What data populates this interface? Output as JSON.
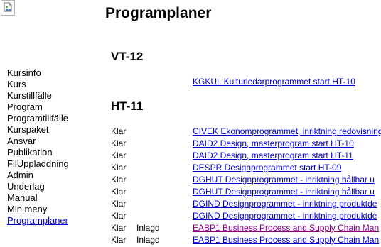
{
  "page": {
    "title": "Programplaner"
  },
  "sidebar": {
    "items": [
      {
        "label": "Kursinfo",
        "active": false
      },
      {
        "label": "Kurs",
        "active": false
      },
      {
        "label": "Kurstillfälle",
        "active": false
      },
      {
        "label": "Program",
        "active": false
      },
      {
        "label": "Programtillfälle",
        "active": false
      },
      {
        "label": "Kurspaket",
        "active": false
      },
      {
        "label": "Ansvar",
        "active": false
      },
      {
        "label": "Publikation",
        "active": false
      },
      {
        "label": "FilUppladdning",
        "active": false
      },
      {
        "label": "Admin",
        "active": false
      },
      {
        "label": "Underlag",
        "active": false
      },
      {
        "label": "Manual",
        "active": false
      },
      {
        "label": "Min meny",
        "active": false
      },
      {
        "label": "Programplaner",
        "active": true
      }
    ]
  },
  "sections": [
    {
      "heading": "VT-12",
      "rows": [
        {
          "status": "",
          "registered": "",
          "link": "KGKUL Kulturledarprogrammet start HT-10",
          "visited": false
        }
      ]
    },
    {
      "heading": "HT-11",
      "rows": [
        {
          "status": "Klar",
          "registered": "",
          "link": "CIVEK Ekonomprogrammet, inriktning redovisning",
          "visited": false
        },
        {
          "status": "Klar",
          "registered": "",
          "link": "DAID2 Design, masterprogram start HT-10",
          "visited": false
        },
        {
          "status": "Klar",
          "registered": "",
          "link": "DAID2 Design, masterprogram start HT-11",
          "visited": false
        },
        {
          "status": "Klar",
          "registered": "",
          "link": "DESPR Designprogrammet start HT-09",
          "visited": false
        },
        {
          "status": "Klar",
          "registered": "",
          "link": "DGHUT Designprogrammet - inriktning hållbar u",
          "visited": false
        },
        {
          "status": "Klar",
          "registered": "",
          "link": "DGHUT Designprogrammet - inriktning hållbar u",
          "visited": false
        },
        {
          "status": "Klar",
          "registered": "",
          "link": "DGIND Designprogrammet - inriktning produktde",
          "visited": false
        },
        {
          "status": "Klar",
          "registered": "",
          "link": "DGIND Designprogrammet - inriktning produktde",
          "visited": false
        },
        {
          "status": "Klar",
          "registered": "Inlagd",
          "link": "EABP1 Business Process and Supply Chain Man",
          "visited": true
        },
        {
          "status": "Klar",
          "registered": "Inlagd",
          "link": "EABP1 Business Process and Supply Chain Man",
          "visited": false
        }
      ]
    }
  ]
}
